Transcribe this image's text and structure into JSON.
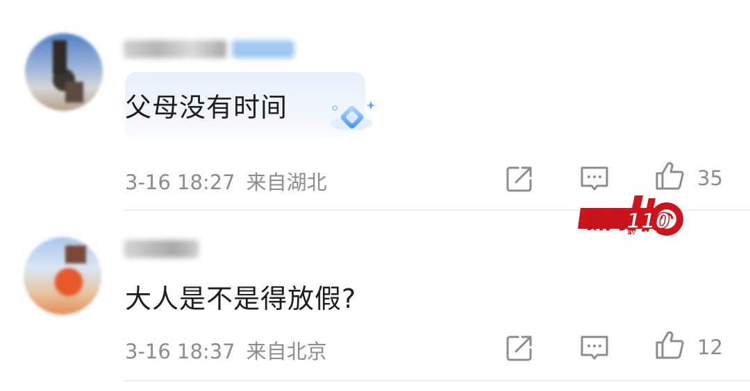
{
  "comments": [
    {
      "text": "父母没有时间",
      "timestamp": "3-16 18:27",
      "location": "来自湖北",
      "likes": "35"
    },
    {
      "text": "大人是不是得放假?",
      "timestamp": "3-16 18:37",
      "location": "来自北京",
      "likes": "12"
    }
  ],
  "watermark": {
    "brand": "新闻110",
    "sub": "NEWS 110"
  },
  "colors": {
    "meta_gray": "#8c8c8c",
    "bubble_blue": "#e7f0fb",
    "watermark_red": "#d0121b"
  },
  "icons": [
    "share-icon",
    "reply-icon",
    "like-icon",
    "diamond-badge-icon"
  ]
}
